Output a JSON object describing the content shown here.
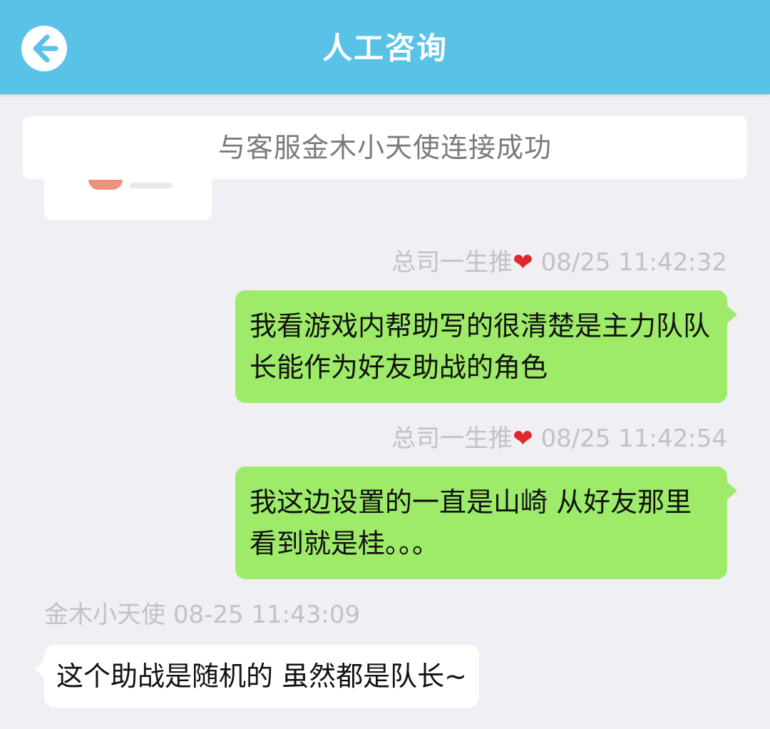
{
  "header": {
    "title": "人工咨询",
    "back_icon": "arrow-left-circle-icon"
  },
  "system": {
    "banner": "与客服金木小天使连接成功"
  },
  "messages": [
    {
      "sender": "总司一生推",
      "heart": "❤",
      "time": "08/25 11:42:32",
      "text": "我看游戏内帮助写的很清楚是主力队队长能作为好友助战的角色"
    },
    {
      "sender": "总司一生推",
      "heart": "❤",
      "time": "08/25 11:42:54",
      "text": "我这边设置的一直是山崎 从好友那里看到就是桂。。。"
    },
    {
      "sender": "金木小天使",
      "time": "08-25 11:43:09",
      "text": "这个助战是随机的 虽然都是队长~"
    }
  ],
  "colors": {
    "header_bg": "#5bc2e7",
    "chat_bg": "#efeff4",
    "my_bubble": "#9eeb6a",
    "their_bubble": "#ffffff",
    "heart": "#e0262f"
  }
}
